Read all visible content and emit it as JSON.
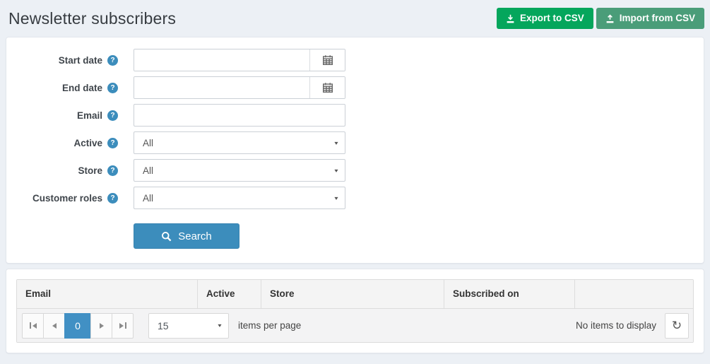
{
  "header": {
    "title": "Newsletter subscribers",
    "export_button": "Export to CSV",
    "import_button": "Import from CSV"
  },
  "search": {
    "start_date": {
      "label": "Start date",
      "value": ""
    },
    "end_date": {
      "label": "End date",
      "value": ""
    },
    "email": {
      "label": "Email",
      "value": ""
    },
    "active": {
      "label": "Active",
      "selected": "All"
    },
    "store": {
      "label": "Store",
      "selected": "All"
    },
    "customer_roles": {
      "label": "Customer roles",
      "selected": "All"
    },
    "button": "Search"
  },
  "grid": {
    "columns": {
      "email": "Email",
      "active": "Active",
      "store": "Store",
      "subscribed_on": "Subscribed on",
      "actions": ""
    },
    "pager": {
      "current_page": "0",
      "page_size": "15",
      "items_per_page_label": "items per page",
      "status": "No items to display"
    }
  },
  "icons": {
    "help": "?",
    "caret_down": "▾",
    "refresh": "↻"
  },
  "colors": {
    "accent_blue": "#3c8dbc",
    "export_green": "#05a65c",
    "import_green": "#4a9d79",
    "pager_active_blue": "#4190c4",
    "page_background": "#ecf0f5"
  }
}
